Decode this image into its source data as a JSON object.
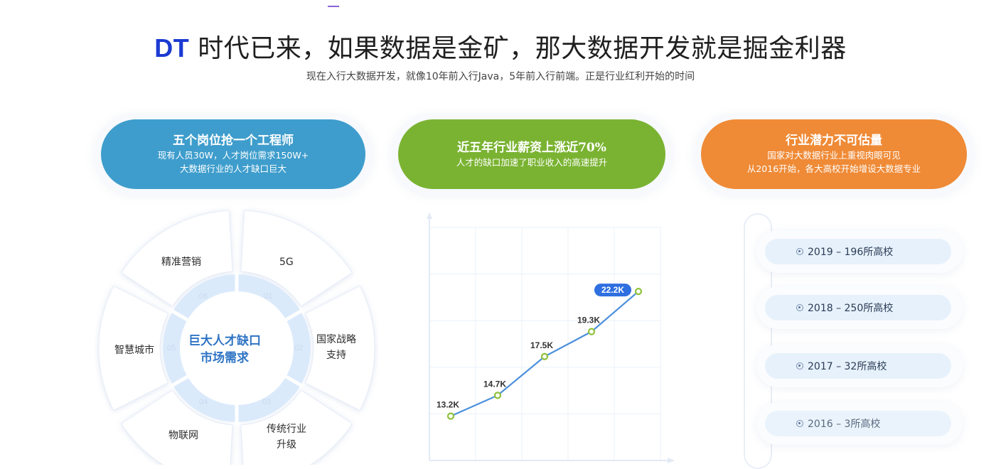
{
  "hero": {
    "title_highlight": "DT",
    "title_rest": " 时代已来，如果数据是金矿，那大数据开发就是掘金利器",
    "subtitle": "现在入行大数据开发，就像10年前入行Java，5年前入行前端。正是行业红利开始的时间"
  },
  "cards": [
    {
      "title": "五个岗位抢一个工程师",
      "lines": [
        "现有人员30W，人才岗位需求150W+",
        "大数据行业的人才缺口巨大"
      ],
      "color": "#3e9dcc"
    },
    {
      "title": "近五年行业薪资上涨近70%",
      "lines": [
        "人才的缺口加速了职业收入的高速提升"
      ],
      "color": "#7ab332"
    },
    {
      "title": "行业潜力不可估量",
      "lines": [
        "国家对大数据行业上重视肉眼可见",
        "从2016开始，各大高校开始增设大数据专业"
      ],
      "color": "#ef8a36"
    }
  ],
  "radial": {
    "center_line1": "巨大人才缺口",
    "center_line2": "市场需求",
    "segments": [
      {
        "num": "01",
        "label": "5G"
      },
      {
        "num": "02",
        "label": "国家战略\n支持"
      },
      {
        "num": "03",
        "label": "传统行业\n升级"
      },
      {
        "num": "04",
        "label": "物联网"
      },
      {
        "num": "05",
        "label": "智慧城市"
      },
      {
        "num": "06",
        "label": "精准营销"
      }
    ]
  },
  "chart_data": {
    "type": "line",
    "values": [
      13.2,
      14.7,
      17.5,
      19.3,
      22.2
    ],
    "labels": [
      "13.2K",
      "14.7K",
      "17.5K",
      "19.3K",
      "22.2K"
    ],
    "highlight_index": 4,
    "ylim": [
      10,
      26
    ],
    "grid": true,
    "line_color": "#4a8fdc",
    "point_color": "#8fc13a"
  },
  "timeline": [
    {
      "text": "2019 – 196所高校"
    },
    {
      "text": "2018 – 250所高校"
    },
    {
      "text": "2017 – 32所高校"
    },
    {
      "text": "2016 – 3所高校"
    }
  ]
}
